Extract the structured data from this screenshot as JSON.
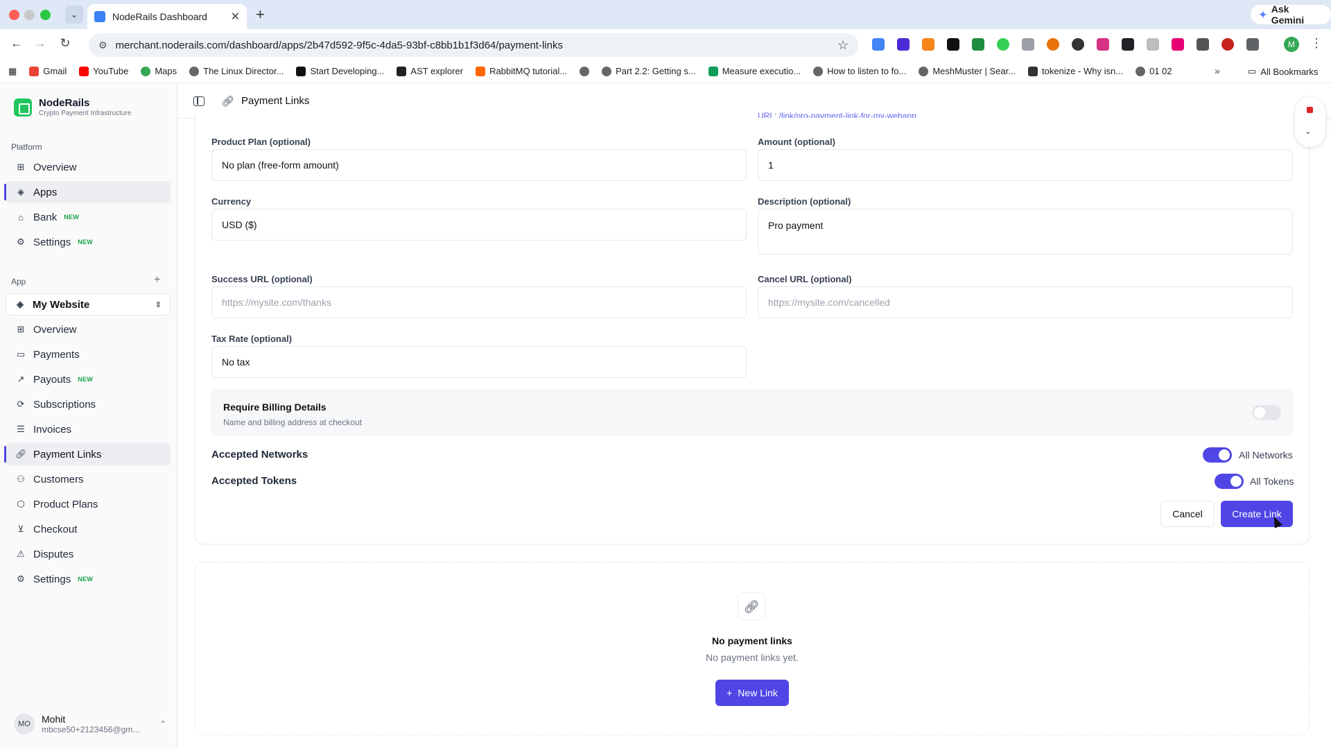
{
  "browser": {
    "tab_title": "NodeRails Dashboard",
    "ask_gemini": "Ask Gemini",
    "url": "merchant.noderails.com/dashboard/apps/2b47d592-9f5c-4da5-93bf-c8bb1b1f3d64/payment-links",
    "profile_initial": "M",
    "bookmarks": [
      "Gmail",
      "YouTube",
      "Maps",
      "The Linux Director...",
      "Start Developing...",
      "AST explorer",
      "RabbitMQ tutorial...",
      "",
      "Part 2.2: Getting s...",
      "Measure executio...",
      "How to listen to fo...",
      "MeshMuster | Sear...",
      "tokenize - Why isn...",
      "01 02"
    ],
    "all_bookmarks": "All Bookmarks"
  },
  "brand": {
    "name": "NodeRails",
    "subtitle": "Crypto Payment Infrastructure"
  },
  "sidebar": {
    "platform_label": "Platform",
    "platform_items": [
      {
        "label": "Overview",
        "icon": "grid-icon",
        "badge": ""
      },
      {
        "label": "Apps",
        "icon": "layers-icon",
        "badge": ""
      },
      {
        "label": "Bank",
        "icon": "bank-icon",
        "badge": "NEW"
      },
      {
        "label": "Settings",
        "icon": "gear-icon",
        "badge": "NEW"
      }
    ],
    "app_label": "App",
    "app_selected": "My Website",
    "app_items": [
      {
        "label": "Overview",
        "icon": "grid-icon",
        "badge": ""
      },
      {
        "label": "Payments",
        "icon": "card-icon",
        "badge": ""
      },
      {
        "label": "Payouts",
        "icon": "arrow-up-right-icon",
        "badge": "NEW"
      },
      {
        "label": "Subscriptions",
        "icon": "refresh-icon",
        "badge": ""
      },
      {
        "label": "Invoices",
        "icon": "list-icon",
        "badge": ""
      },
      {
        "label": "Payment Links",
        "icon": "link-icon",
        "badge": ""
      },
      {
        "label": "Customers",
        "icon": "users-icon",
        "badge": ""
      },
      {
        "label": "Product Plans",
        "icon": "box-icon",
        "badge": ""
      },
      {
        "label": "Checkout",
        "icon": "cart-icon",
        "badge": ""
      },
      {
        "label": "Disputes",
        "icon": "warning-icon",
        "badge": ""
      },
      {
        "label": "Settings",
        "icon": "gear-icon",
        "badge": "NEW"
      }
    ],
    "user": {
      "initials": "MO",
      "name": "Mohit",
      "email": "mbcse50+2123456@gm..."
    }
  },
  "header": {
    "title": "Payment Links"
  },
  "form": {
    "cut_hint": "URL: /link/pro-payment-link-for-my-webapp",
    "product_plan": {
      "label": "Product Plan (optional)",
      "value": "No plan (free-form amount)"
    },
    "amount": {
      "label": "Amount (optional)",
      "value": "1"
    },
    "currency": {
      "label": "Currency",
      "value": "USD ($)"
    },
    "description": {
      "label": "Description (optional)",
      "value": "Pro payment"
    },
    "success_url": {
      "label": "Success URL (optional)",
      "placeholder": "https://mysite.com/thanks"
    },
    "cancel_url": {
      "label": "Cancel URL (optional)",
      "placeholder": "https://mysite.com/cancelled"
    },
    "tax_rate": {
      "label": "Tax Rate (optional)",
      "value": "No tax"
    },
    "billing": {
      "title": "Require Billing Details",
      "subtitle": "Name and billing address at checkout",
      "enabled": false
    },
    "networks": {
      "label": "Accepted Networks",
      "value": "All Networks",
      "enabled": true
    },
    "tokens": {
      "label": "Accepted Tokens",
      "value": "All Tokens",
      "enabled": true
    },
    "cancel_label": "Cancel",
    "create_label": "Create Link"
  },
  "empty_state": {
    "title": "No payment links",
    "subtitle": "No payment links yet.",
    "button_label": "New Link"
  },
  "colors": {
    "accent": "#4f46e5",
    "brand": "#22c55e",
    "new_badge": "#16a34a"
  }
}
